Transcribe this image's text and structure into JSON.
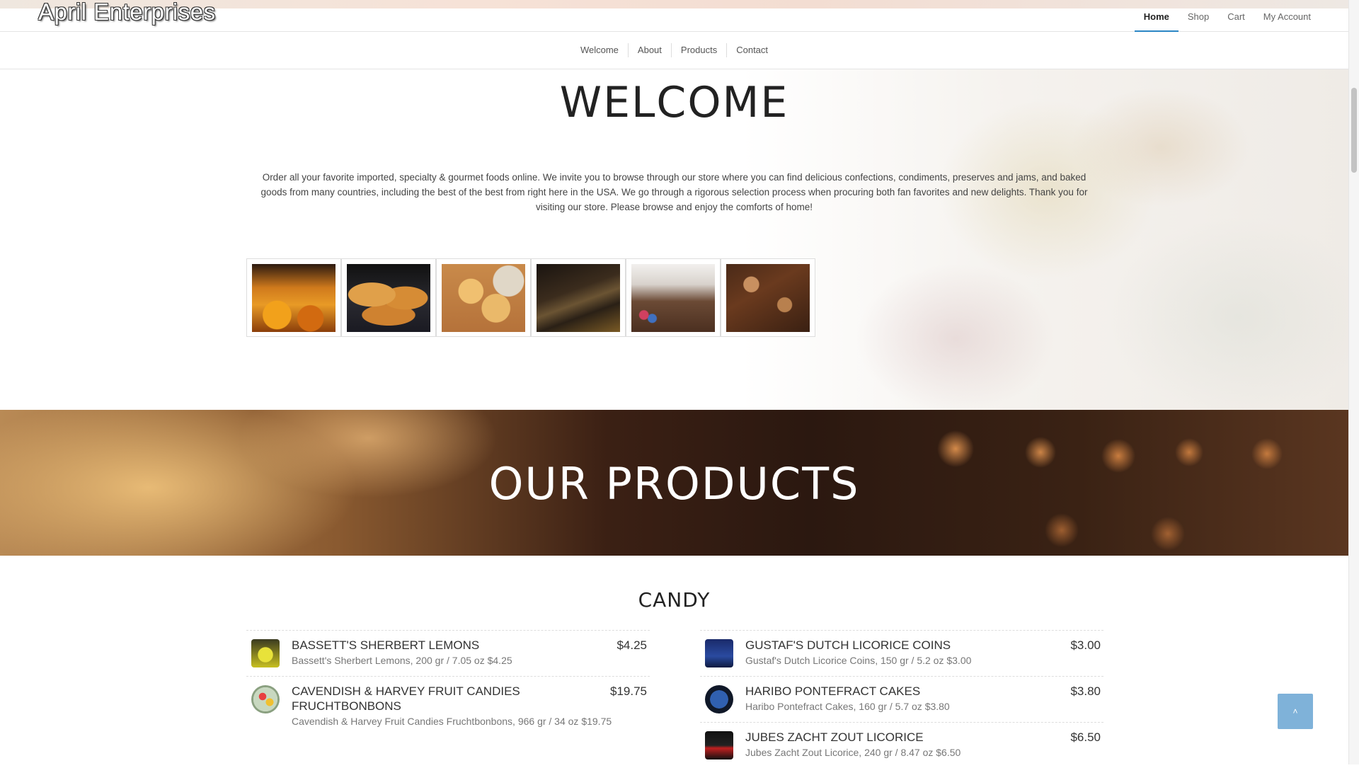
{
  "header": {
    "logo": "April Enterprises",
    "nav": [
      "Home",
      "Shop",
      "Cart",
      "My Account"
    ],
    "active_nav": "Home"
  },
  "subnav": [
    "Welcome",
    "About",
    "Products",
    "Contact"
  ],
  "welcome": {
    "title": "WELCOME",
    "intro": "Order all your favorite imported, specialty & gourmet foods online. We invite you to browse through our store where you can find delicious confections, condiments, preserves and jams, and baked goods from many countries, including the best of the best from right here in the USA. We go through a rigorous selection process when procuring both fan favorites and new delights. Thank you for visiting our store. Please browse and enjoy the comforts of home!",
    "gallery": [
      "jars of preserves with apricots",
      "butter cookies on a plate",
      "heart-shaped shortbread cookies",
      "chocolate bar pieces",
      "chocolate with candies and flowers",
      "chocolate bark with nuts"
    ]
  },
  "products_banner": {
    "title": "OUR PRODUCTS"
  },
  "candy": {
    "title": "CANDY",
    "left": [
      {
        "name": "BASSETT'S SHERBERT LEMONS",
        "price": "$4.25",
        "desc": "Bassett's Sherbert Lemons, 200 gr / 7.05 oz $4.25",
        "icon": "product-thumb-lemon"
      },
      {
        "name": "CAVENDISH & HARVEY FRUIT CANDIES FRUCHTBONBONS",
        "price": "$19.75",
        "desc": "Cavendish & Harvey Fruit Candies Fruchtbonbons, 966 gr / 34 oz $19.75",
        "icon": "product-thumb-cavendish"
      }
    ],
    "right": [
      {
        "name": "GUSTAF'S DUTCH LICORICE COINS",
        "price": "$3.00",
        "desc": "Gustaf's Dutch Licorice Coins, 150 gr / 5.2 oz $3.00",
        "icon": "product-thumb-gustaf"
      },
      {
        "name": "HARIBO PONTEFRACT CAKES",
        "price": "$3.80",
        "desc": "Haribo Pontefract Cakes, 160 gr / 5.7 oz $3.80",
        "icon": "product-thumb-haribo"
      },
      {
        "name": "JUBES ZACHT ZOUT LICORICE",
        "price": "$6.50",
        "desc": "Jubes Zacht Zout Licorice, 240 gr / 8.47 oz $6.50",
        "icon": "product-thumb-jubes"
      }
    ]
  },
  "colors": {
    "accent": "#2b86c5",
    "to_top": "#7fb2d9"
  },
  "to_top_icon": "chevron-up-icon"
}
